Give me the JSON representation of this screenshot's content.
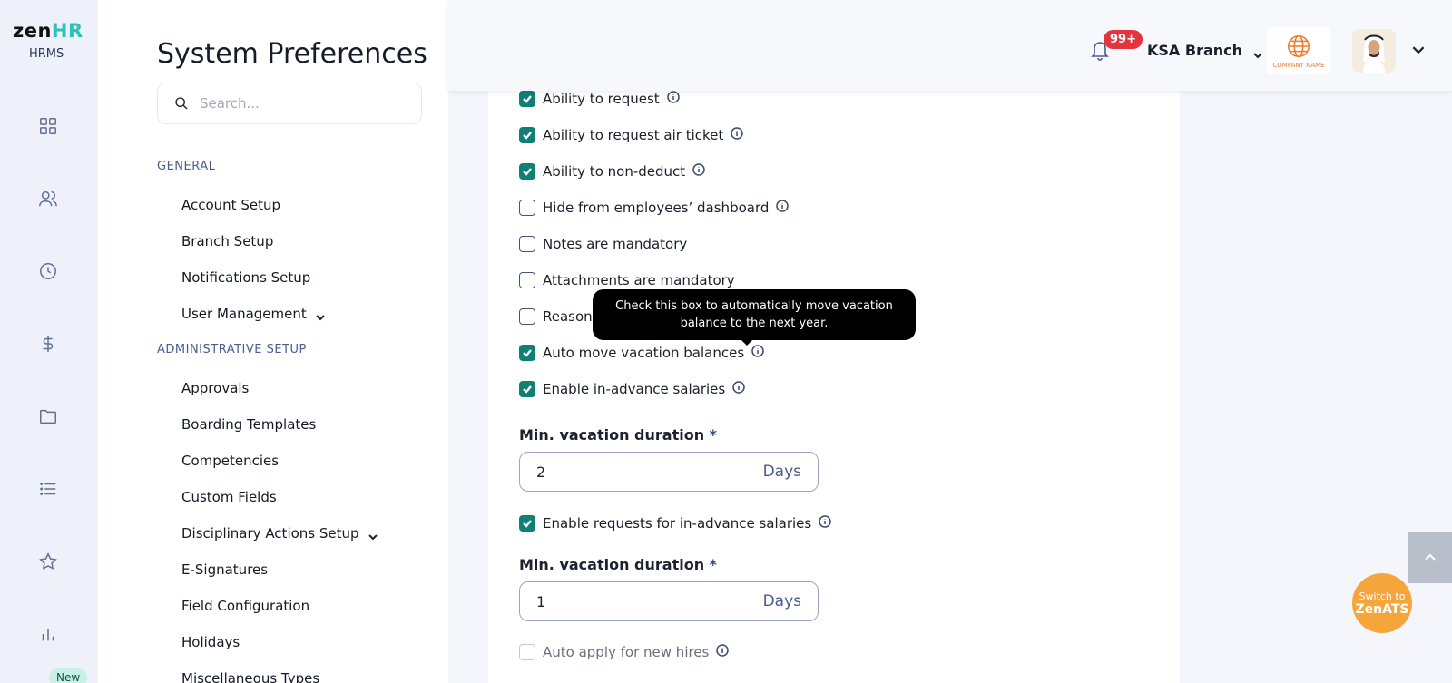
{
  "brand": {
    "logo_main": "zen",
    "logo_accent": "HR",
    "subtitle": "HRMS",
    "new_badge": "New"
  },
  "rail_icons": [
    "dashboard-icon",
    "people-icon",
    "clock-icon",
    "dollar-icon",
    "folder-icon",
    "list-icon",
    "star-icon",
    "chart-icon"
  ],
  "settings": {
    "title": "System Preferences",
    "search_placeholder": "Search...",
    "sections": [
      {
        "heading": "GENERAL",
        "items": [
          "Account Setup",
          "Branch Setup",
          "Notifications Setup",
          "User Management"
        ]
      },
      {
        "heading": "ADMINISTRATIVE SETUP",
        "items": [
          "Approvals",
          "Boarding Templates",
          "Competencies",
          "Custom Fields",
          "Disciplinary Actions Setup",
          "E-Signatures",
          "Field Configuration",
          "Holidays",
          "Miscellaneous Types"
        ]
      }
    ]
  },
  "header": {
    "notification_count": "99+",
    "branch": "KSA Branch",
    "company_logo_text": "COMPANY NAME"
  },
  "options": [
    {
      "label": "Ability to request",
      "checked": true,
      "info": true
    },
    {
      "label": "Ability to request air ticket",
      "checked": true,
      "info": true
    },
    {
      "label": "Ability to non-deduct",
      "checked": true,
      "info": true
    },
    {
      "label": "Hide from employees’ dashboard",
      "checked": false,
      "info": true
    },
    {
      "label": "Notes are mandatory",
      "checked": false,
      "info": false
    },
    {
      "label": "Attachments are mandatory",
      "checked": false,
      "info": false
    },
    {
      "label": "Reason",
      "checked": false,
      "info": false
    },
    {
      "label": "Auto move vacation balances",
      "checked": true,
      "info": true
    },
    {
      "label": "Enable in-advance salaries",
      "checked": true,
      "info": true
    }
  ],
  "tooltip": "Check this box to automatically move vacation balance to the next year.",
  "field1": {
    "label": "Min. vacation duration",
    "required": "*",
    "value": "2",
    "unit": "Days"
  },
  "option_requests": {
    "label": "Enable requests for in-advance salaries",
    "checked": true
  },
  "field2": {
    "label": "Min. vacation duration",
    "required": "*",
    "value": "1",
    "unit": "Days"
  },
  "option_auto_apply": {
    "label": "Auto apply for new hires",
    "checked": false
  },
  "switch_ats": {
    "line1": "Switch to",
    "line2": "ZenATS"
  },
  "colors": {
    "accent": "#0e8075",
    "badge": "#e4343e",
    "ats": "#f6a53b"
  }
}
